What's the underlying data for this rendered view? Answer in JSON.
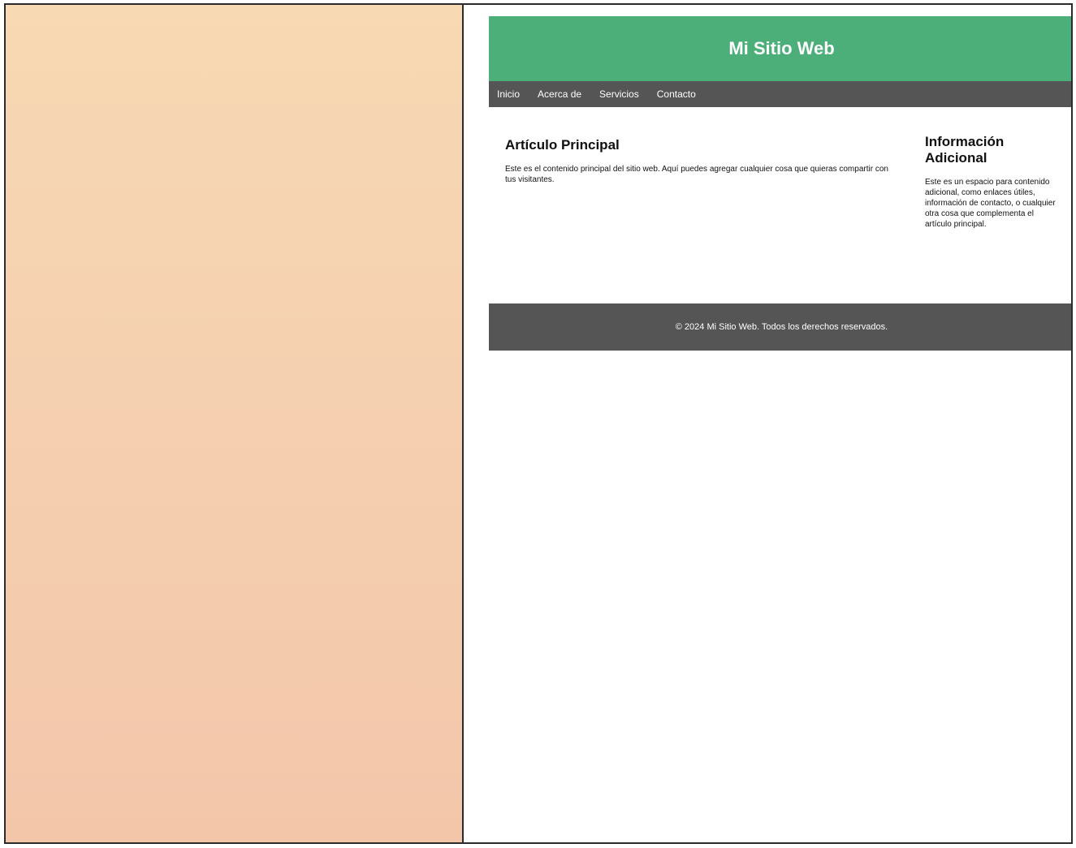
{
  "site": {
    "title": "Mi Sitio Web",
    "nav": [
      {
        "label": "Inicio"
      },
      {
        "label": "Acerca de"
      },
      {
        "label": "Servicios"
      },
      {
        "label": "Contacto"
      }
    ],
    "main": {
      "heading": "Artículo Principal",
      "body": "Este es el contenido principal del sitio web. Aquí puedes agregar cualquier cosa que quieras compartir con tus visitantes."
    },
    "aside": {
      "heading": "Información Adicional",
      "body": "Este es un espacio para contenido adicional, como enlaces útiles, información de contacto, o cualquier otra cosa que complementa el artículo principal."
    },
    "footer": {
      "text": "© 2024 Mi Sitio Web. Todos los derechos reservados."
    }
  },
  "colors": {
    "header_bg": "#4cae78",
    "nav_bg": "#555555",
    "footer_bg": "#555555",
    "left_panel_bg": "#f5d0b0"
  }
}
